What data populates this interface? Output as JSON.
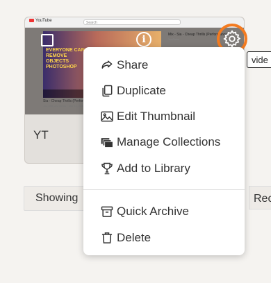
{
  "video_card": {
    "title": "YT",
    "thumbnail": {
      "site_logo": "YouTube",
      "search_placeholder": "Search",
      "video_caption": "EVERYONE CAN REMOVE OBJECTS PHOTOSHOP",
      "side_title": "Mix - Sia - Cheap Thrills (Performance)",
      "side_subtitle": "YouTube",
      "below_title": "Sia - Cheap Thrills (Performa",
      "below_subtitle": "112,558,022 views • Mar 11, 2016"
    },
    "icons": [
      "checkbox",
      "info-icon",
      "gear-icon"
    ],
    "accent_color": "#f47b20"
  },
  "tooltip": {
    "text": "vide"
  },
  "filter_bar": {
    "showing_label": "Showing",
    "right_label": "Rec"
  },
  "context_menu": {
    "items": [
      {
        "label": "Share",
        "icon": "share-icon"
      },
      {
        "label": "Duplicate",
        "icon": "duplicate-icon"
      },
      {
        "label": "Edit Thumbnail",
        "icon": "image-icon"
      },
      {
        "label": "Manage Collections",
        "icon": "collections-icon"
      },
      {
        "label": "Add to Library",
        "icon": "trophy-icon"
      },
      {
        "label": "Quick Archive",
        "icon": "archive-icon"
      },
      {
        "label": "Delete",
        "icon": "trash-icon"
      }
    ]
  }
}
